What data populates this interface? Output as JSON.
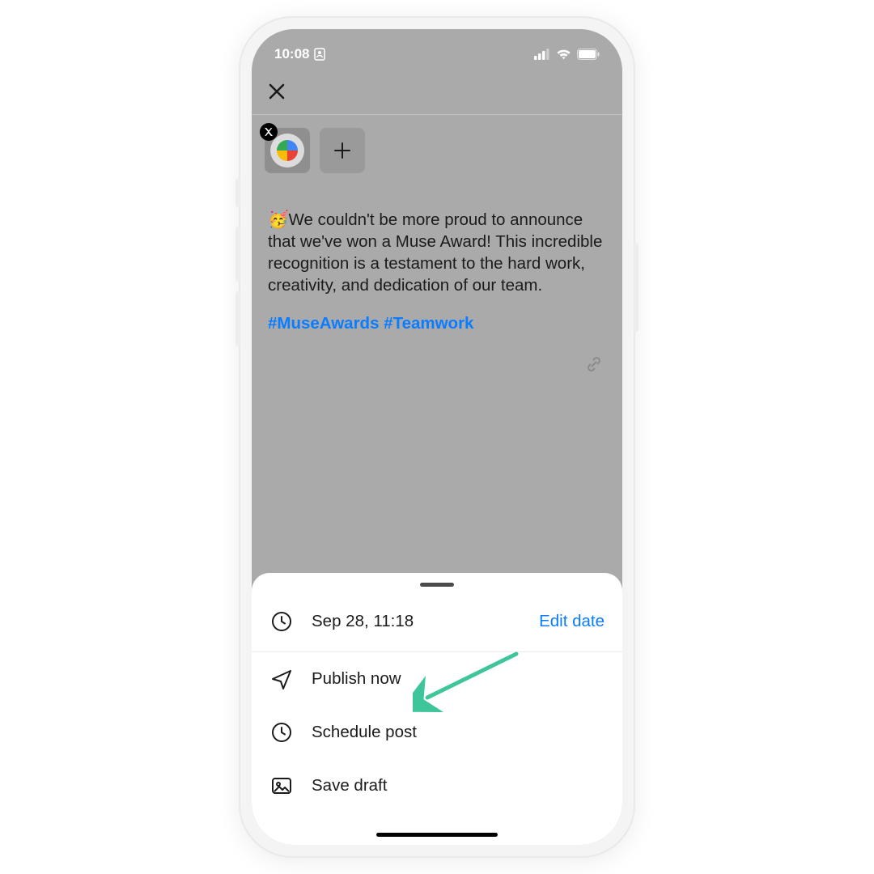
{
  "statusbar": {
    "time": "10:08"
  },
  "compose": {
    "emoji": "🥳",
    "text": "We couldn't be more proud to announce that we've won a Muse Award! This incredible recognition is a testament to the hard work, creativity, and dedication of our team.",
    "hashtags": "#MuseAwards #Teamwork"
  },
  "sheet": {
    "date": "Sep 28, 11:18",
    "edit_label": "Edit date",
    "actions": {
      "publish": "Publish now",
      "schedule": "Schedule post",
      "draft": "Save draft"
    }
  }
}
